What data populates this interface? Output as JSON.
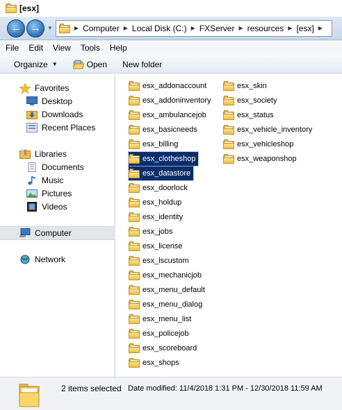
{
  "window": {
    "title": "[esx]"
  },
  "navigation": {
    "back_glyph": "←",
    "forward_glyph": "→",
    "breadcrumbs": [
      "Computer",
      "Local Disk (C:)",
      "FXServer",
      "resources",
      "[esx]"
    ]
  },
  "menubar": {
    "items": [
      "File",
      "Edit",
      "View",
      "Tools",
      "Help"
    ]
  },
  "toolbar": {
    "organize_label": "Organize",
    "open_label": "Open",
    "new_folder_label": "New folder"
  },
  "sidebar": {
    "favorites": {
      "label": "Favorites",
      "items": [
        "Desktop",
        "Downloads",
        "Recent Places"
      ]
    },
    "libraries": {
      "label": "Libraries",
      "items": [
        "Documents",
        "Music",
        "Pictures",
        "Videos"
      ]
    },
    "computer": {
      "label": "Computer"
    },
    "network": {
      "label": "Network"
    }
  },
  "files": {
    "column1": [
      "esx_addonaccount",
      "esx_addoninventory",
      "esx_ambulancejob",
      "esx_basicneeds",
      "esx_billing",
      "esx_clotheshop",
      "esx_datastore",
      "esx_doorlock",
      "esx_holdup",
      "esx_identity",
      "esx_jobs",
      "esx_license",
      "esx_lscustom",
      "esx_mechanicjob",
      "esx_menu_default",
      "esx_menu_dialog",
      "esx_menu_list",
      "esx_policejob",
      "esx_scoreboard",
      "esx_shops"
    ],
    "column2": [
      "esx_skin",
      "esx_society",
      "esx_status",
      "esx_vehicle_inventory",
      "esx_vehicleshop",
      "esx_weaponshop"
    ],
    "selected": [
      "esx_clotheshop",
      "esx_datastore"
    ]
  },
  "status": {
    "selection_text": "2 items selected",
    "date_text": "Date modified: 11/4/2018 1:31 PM - 12/30/2018 11:59 AM"
  }
}
